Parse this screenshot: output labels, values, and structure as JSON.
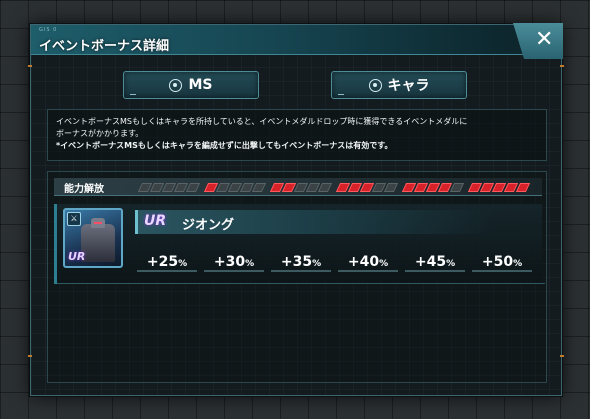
{
  "dialog": {
    "code": "GIS 0",
    "title": "イベントボーナス詳細",
    "close_label": "✕"
  },
  "tabs": [
    {
      "label": "MS",
      "icon": "target-icon"
    },
    {
      "label": "キャラ",
      "icon": "target-icon"
    }
  ],
  "info": {
    "line1": "イベントボーナスMSもしくはキャラを所持していると、イベントメダルドロップ時に獲得できるイベントメダルに",
    "line2": "ボーナスがかかります。",
    "note": "*イベントボーナスMSもしくはキャラを編成せずに出撃してもイベントボーナスは有効です。"
  },
  "ability": {
    "label": "能力解放",
    "levels": [
      {
        "filled": 0
      },
      {
        "filled": 1
      },
      {
        "filled": 2
      },
      {
        "filled": 3
      },
      {
        "filled": 4
      },
      {
        "filled": 5
      }
    ]
  },
  "unit": {
    "rarity": "UR",
    "thumb_rarity": "UR",
    "name": "ジオング",
    "bonuses": [
      {
        "value": "+25",
        "unit": "%"
      },
      {
        "value": "+30",
        "unit": "%"
      },
      {
        "value": "+35",
        "unit": "%"
      },
      {
        "value": "+40",
        "unit": "%"
      },
      {
        "value": "+45",
        "unit": "%"
      },
      {
        "value": "+50",
        "unit": "%"
      }
    ]
  }
}
